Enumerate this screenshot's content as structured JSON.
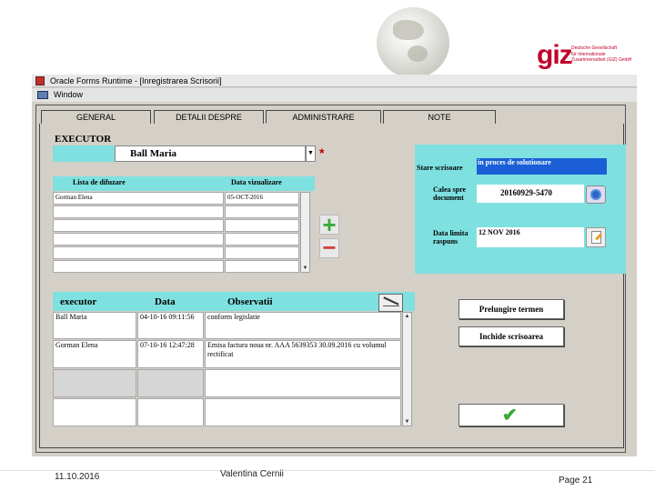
{
  "branding": {
    "giz_mark": "giz",
    "giz_lines": [
      "Deutsche Gesellschaft",
      "für Internationale",
      "Zusammenarbeit (GIZ) GmbH"
    ],
    "accent_color": "#c0002a"
  },
  "window": {
    "title": "Oracle Forms Runtime - [Inregistrarea Scrisorii]",
    "menu_label": "Window"
  },
  "tabs": [
    {
      "label": "GENERAL",
      "active": false
    },
    {
      "label": "DETALII DESPRE EXPEDITOR",
      "active": false
    },
    {
      "label": "ADMINISTRARE",
      "active": true
    },
    {
      "label": "NOTE",
      "active": false
    }
  ],
  "executor": {
    "section_label": "EXECUTOR",
    "selected_value": "Ball Maria",
    "required_mark": "*",
    "dropdown_glyph": "▼"
  },
  "difuzare": {
    "headers": [
      "Lista de difuzare",
      "Data vizualizare"
    ],
    "rows": [
      [
        "Gorman Elena",
        "05-OCT-2016"
      ],
      [
        "",
        ""
      ],
      [
        "",
        ""
      ],
      [
        "",
        ""
      ],
      [
        "",
        ""
      ],
      [
        "",
        ""
      ]
    ],
    "add_glyph": "+",
    "remove_glyph": "−"
  },
  "status_panel": {
    "stare_label": "Stare scrisoare",
    "stare_value": "in proces de solutionare",
    "calea_label_1": "Calea spre",
    "calea_label_2": "document",
    "calea_value": "20160929-5470",
    "data_label_1": "Data limita",
    "data_label_2": "raspuns",
    "data_value": "12 NOV 2016"
  },
  "executor_table": {
    "headers": [
      "executor",
      "Data",
      "Observatii"
    ],
    "rows": [
      {
        "executor": "Ball Maria",
        "data": "04-10-16 09:11:56",
        "obs": "conform legislatie"
      },
      {
        "executor": "Gorman Elena",
        "data": "07-10-16 12:47:28",
        "obs": "Emisa factura noua nr. AAA 5639353 30.09.2016 cu volumul rectificat"
      },
      {
        "executor": "",
        "data": "",
        "obs": ""
      },
      {
        "executor": "",
        "data": "",
        "obs": ""
      }
    ]
  },
  "actions": {
    "prelungire": "Prelungire termen",
    "inchide": "Inchide scrisoarea",
    "ok_glyph": "✔"
  },
  "footer": {
    "date": "11.10.2016",
    "author": "Valentina Cernii",
    "page": "Page 21"
  }
}
